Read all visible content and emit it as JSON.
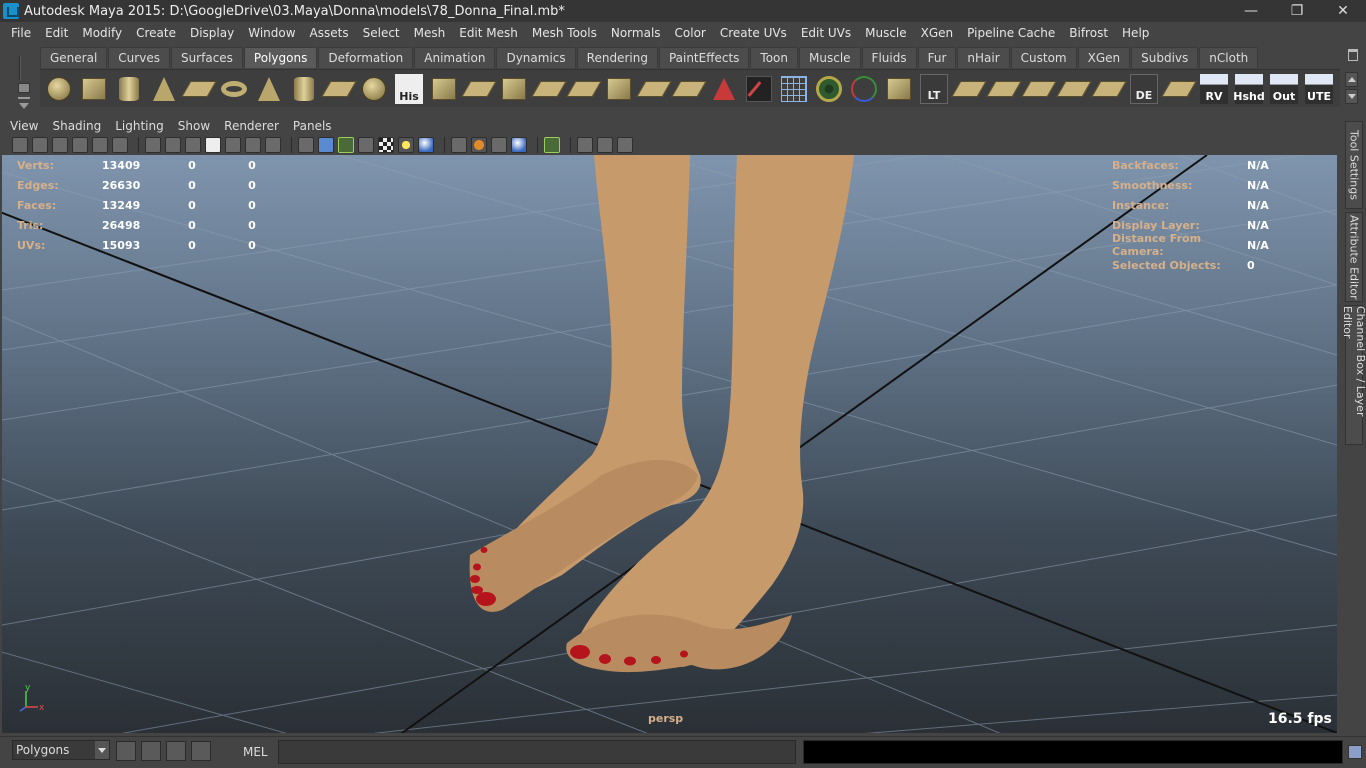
{
  "window": {
    "title": "Autodesk Maya 2015: D:\\GoogleDrive\\03.Maya\\Donna\\models\\78_Donna_Final.mb*",
    "controls": {
      "minimize": "—",
      "restore": "❐",
      "close": "✕"
    }
  },
  "menubar": [
    "File",
    "Edit",
    "Modify",
    "Create",
    "Display",
    "Window",
    "Assets",
    "Select",
    "Mesh",
    "Edit Mesh",
    "Mesh Tools",
    "Normals",
    "Color",
    "Create UVs",
    "Edit UVs",
    "Muscle",
    "XGen",
    "Pipeline Cache",
    "Bifrost",
    "Help"
  ],
  "shelf": {
    "tabs": [
      "General",
      "Curves",
      "Surfaces",
      "Polygons",
      "Deformation",
      "Animation",
      "Dynamics",
      "Rendering",
      "PaintEffects",
      "Toon",
      "Muscle",
      "Fluids",
      "Fur",
      "nHair",
      "Custom",
      "XGen",
      "Subdivs",
      "nCloth"
    ],
    "active_tab": "Polygons",
    "icon_labels": {
      "his": "His",
      "lt": "LT",
      "de": "DE",
      "rv": "RV",
      "hshd": "Hshd",
      "out": "Out",
      "ute": "UTE"
    }
  },
  "panel_menu": [
    "View",
    "Shading",
    "Lighting",
    "Show",
    "Renderer",
    "Panels"
  ],
  "hud": {
    "left": [
      {
        "label": "Verts:",
        "v1": "13409",
        "v2": "0",
        "v3": "0"
      },
      {
        "label": "Edges:",
        "v1": "26630",
        "v2": "0",
        "v3": "0"
      },
      {
        "label": "Faces:",
        "v1": "13249",
        "v2": "0",
        "v3": "0"
      },
      {
        "label": "Tris:",
        "v1": "26498",
        "v2": "0",
        "v3": "0"
      },
      {
        "label": "UVs:",
        "v1": "15093",
        "v2": "0",
        "v3": "0"
      }
    ],
    "right": [
      {
        "label": "Backfaces:",
        "value": "N/A"
      },
      {
        "label": "Smoothness:",
        "value": "N/A"
      },
      {
        "label": "Instance:",
        "value": "N/A"
      },
      {
        "label": "Display Layer:",
        "value": "N/A"
      },
      {
        "label": "Distance From Camera:",
        "value": "N/A"
      },
      {
        "label": "Selected Objects:",
        "value": "0"
      }
    ],
    "camera": "persp",
    "fps": "16.5 fps",
    "axis_y": "y",
    "axis_x": "x"
  },
  "side_tabs": [
    "Tool Settings",
    "Attribute Editor",
    "Channel Box / Layer Editor"
  ],
  "statusbar": {
    "mode": "Polygons",
    "mel_label": "MEL",
    "command_value": ""
  },
  "colors": {
    "hud_label": "#d7b08a",
    "skin": "#c79a6c",
    "nail": "#b5141c"
  }
}
